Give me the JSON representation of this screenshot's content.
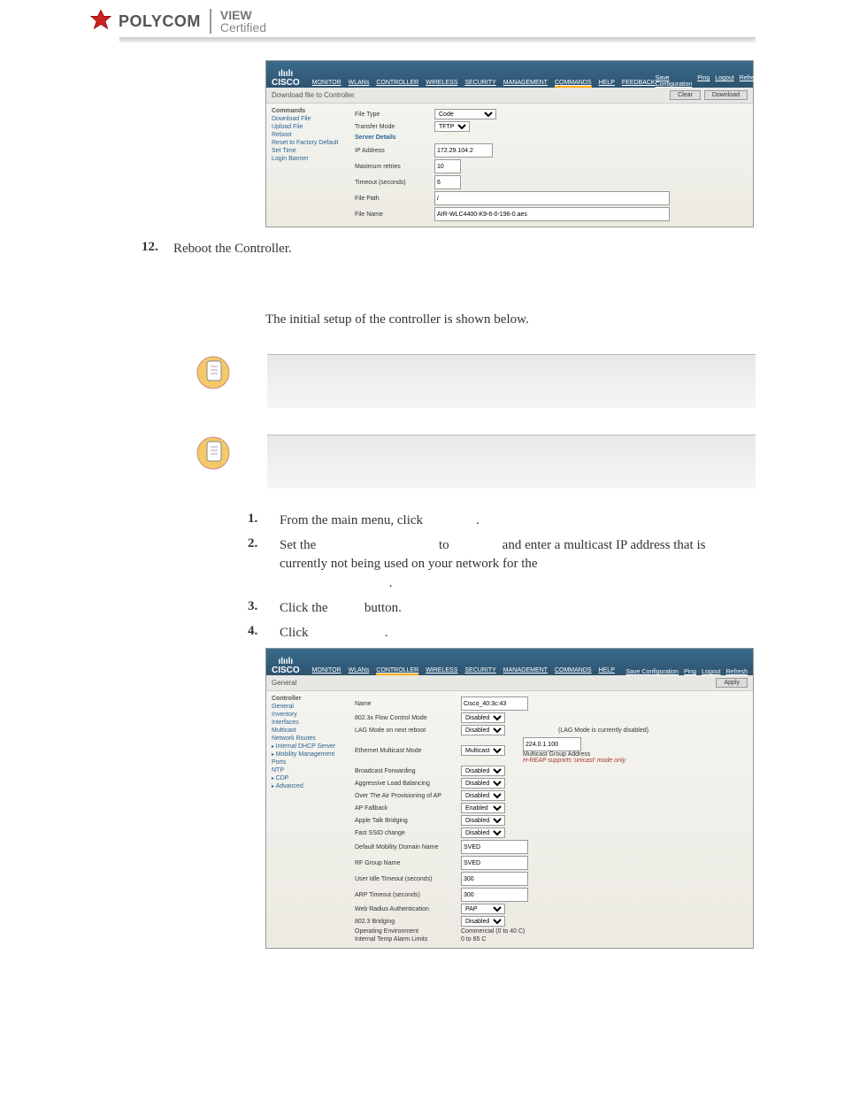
{
  "brand": {
    "name": "POLYCOM",
    "cert_top": "VIEW",
    "cert_bottom": "Certified"
  },
  "step12": {
    "num": "12.",
    "text": "Reboot the Controller."
  },
  "intro_setup": "The initial setup of the controller is shown below.",
  "steps": {
    "s1": {
      "num": "1.",
      "prefix": "From the main menu, click ",
      "suffix": "."
    },
    "s2": {
      "num": "2.",
      "a": "Set the ",
      "b": " to ",
      "c": " and enter a multicast IP address that is currently not being used on your network for the ",
      "d": "."
    },
    "s3": {
      "num": "3.",
      "a": "Click the ",
      "b": " button."
    },
    "s4": {
      "num": "4.",
      "a": "Click ",
      "b": "."
    }
  },
  "shot1": {
    "toplinks": [
      "Save Configuration",
      "Ping",
      "Logout",
      "Refresh"
    ],
    "nav": [
      "MONITOR",
      "WLANs",
      "CONTROLLER",
      "WIRELESS",
      "SECURITY",
      "MANAGEMENT",
      "COMMANDS",
      "HELP",
      "FEEDBACK"
    ],
    "sidebar_heading": "Commands",
    "sidebar": [
      "Download File",
      "Upload File",
      "Reboot",
      "Reset to Factory Default",
      "Set Time",
      "Login Banner"
    ],
    "page_title": "Download file to Controller",
    "buttons": {
      "clear": "Clear",
      "download": "Download"
    },
    "rows": {
      "file_type_lbl": "File Type",
      "file_type_val": "Code",
      "transfer_mode_lbl": "Transfer Mode",
      "transfer_mode_val": "TFTP"
    },
    "server_details": "Server Details",
    "srv": {
      "ip_lbl": "IP Address",
      "ip_val": "172.29.104.2",
      "retries_lbl": "Maximum retries",
      "retries_val": "10",
      "timeout_lbl": "Timeout (seconds)",
      "timeout_val": "6",
      "path_lbl": "File Path",
      "path_val": "/",
      "name_lbl": "File Name",
      "name_val": "AIR-WLC4400-K9-6-0-196-0.aes"
    }
  },
  "shot2": {
    "toplinks": [
      "Save Configuration",
      "Ping",
      "Logout",
      "Refresh"
    ],
    "nav": [
      "MONITOR",
      "WLANs",
      "CONTROLLER",
      "WIRELESS",
      "SECURITY",
      "MANAGEMENT",
      "COMMANDS",
      "HELP"
    ],
    "sidebar_heading": "Controller",
    "sidebar": [
      "General",
      "Inventory",
      "Interfaces",
      "Multicast",
      "Network Routes",
      "Internal DHCP Server",
      "Mobility Management",
      "Ports",
      "NTP",
      "CDP",
      "Advanced"
    ],
    "page_title": "General",
    "apply": "Apply",
    "rows": [
      {
        "lbl": "Name",
        "val": "Cisco_40:3c:43",
        "type": "text"
      },
      {
        "lbl": "802.3x Flow Control Mode",
        "val": "Disabled",
        "type": "select"
      },
      {
        "lbl": "LAG Mode on next reboot",
        "val": "Disabled",
        "type": "select",
        "note": "(LAG Mode is currently disabled)."
      },
      {
        "lbl": "Ethernet Multicast Mode",
        "val": "Multicast",
        "type": "select",
        "mga": "224.0.1.100",
        "mglbl": "Multicast Group Address",
        "mgred": "H-REAP supports 'unicast' mode only."
      },
      {
        "lbl": "Broadcast Forwarding",
        "val": "Disabled",
        "type": "select"
      },
      {
        "lbl": "Aggressive Load Balancing",
        "val": "Disabled",
        "type": "select"
      },
      {
        "lbl": "Over The Air Provisioning of AP",
        "val": "Disabled",
        "type": "select"
      },
      {
        "lbl": "AP Fallback",
        "val": "Enabled",
        "type": "select"
      },
      {
        "lbl": "Apple Talk Bridging",
        "val": "Disabled",
        "type": "select"
      },
      {
        "lbl": "Fast SSID change",
        "val": "Disabled",
        "type": "select"
      },
      {
        "lbl": "Default Mobility Domain Name",
        "val": "SVED",
        "type": "text"
      },
      {
        "lbl": "RF Group Name",
        "val": "SVED",
        "type": "text"
      },
      {
        "lbl": "User Idle Timeout (seconds)",
        "val": "300",
        "type": "text"
      },
      {
        "lbl": "ARP Timeout (seconds)",
        "val": "300",
        "type": "text"
      },
      {
        "lbl": "Web Radius Authentication",
        "val": "PAP",
        "type": "select"
      },
      {
        "lbl": "802.3 Bridging",
        "val": "Disabled",
        "type": "select"
      },
      {
        "lbl": "Operating Environment",
        "val": "Commercial (0 to 40 C)",
        "type": "plain"
      },
      {
        "lbl": "Internal Temp Alarm Limits",
        "val": "0 to 65 C",
        "type": "plain"
      }
    ]
  }
}
